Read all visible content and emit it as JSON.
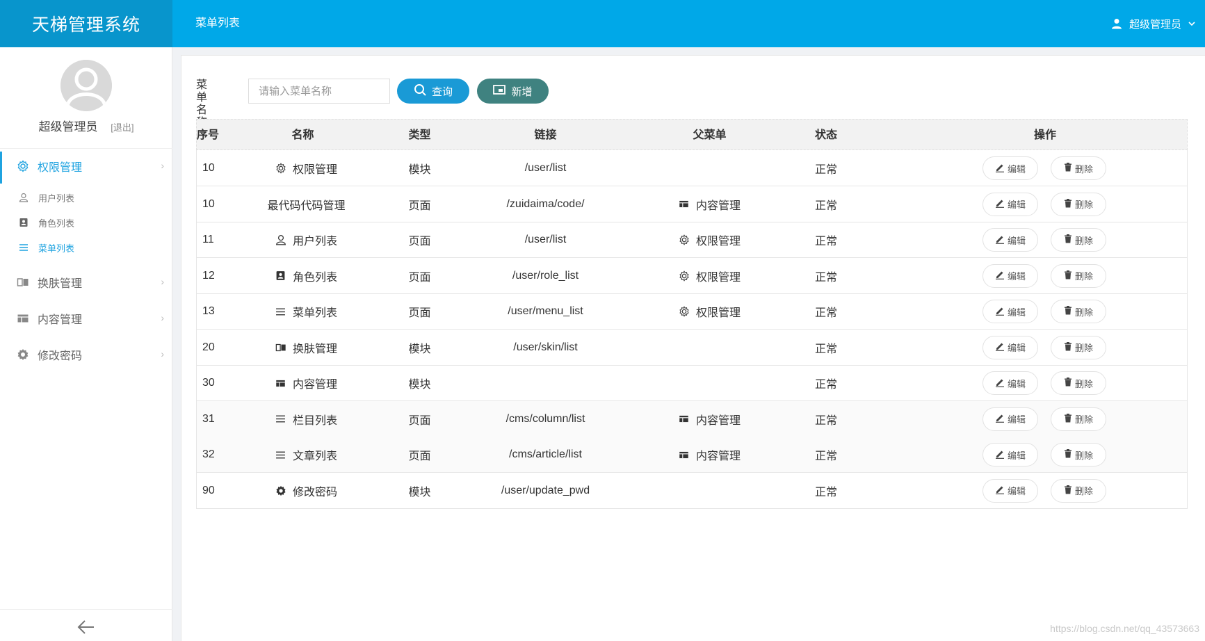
{
  "app": {
    "title": "天梯管理系统"
  },
  "header": {
    "breadcrumb": "菜单列表",
    "user_name": "超级管理员"
  },
  "sidebar": {
    "profile_name": "超级管理员",
    "logout": "[退出]",
    "items": [
      {
        "label": "权限管理",
        "icon": "gear-icon",
        "active": true
      },
      {
        "label": "换肤管理",
        "icon": "book-open-icon",
        "active": false
      },
      {
        "label": "内容管理",
        "icon": "table-icon",
        "active": false
      },
      {
        "label": "修改密码",
        "icon": "cog-icon",
        "active": false
      }
    ],
    "subitems": [
      {
        "label": "用户列表",
        "icon": "user-icon",
        "active": false
      },
      {
        "label": "角色列表",
        "icon": "id-card-icon",
        "active": false
      },
      {
        "label": "菜单列表",
        "icon": "list-icon",
        "active": true
      }
    ]
  },
  "search": {
    "label": "菜单名称",
    "placeholder": "请输入菜单名称",
    "query_button": "查询",
    "add_button": "新增"
  },
  "table": {
    "headers": [
      "序号",
      "名称",
      "类型",
      "链接",
      "父菜单",
      "状态",
      "操作"
    ],
    "edit_label": "编辑",
    "delete_label": "删除",
    "rows": [
      {
        "seq": "10",
        "name": "权限管理",
        "name_icon": "gear-icon",
        "type": "模块",
        "link": "/user/list",
        "parent": "",
        "parent_icon": "",
        "status": "正常"
      },
      {
        "seq": "10",
        "name": "最代码代码管理",
        "name_icon": "",
        "type": "页面",
        "link": "/zuidaima/code/",
        "parent": "内容管理",
        "parent_icon": "table-icon",
        "status": "正常"
      },
      {
        "seq": "11",
        "name": "用户列表",
        "name_icon": "user-icon",
        "type": "页面",
        "link": "/user/list",
        "parent": "权限管理",
        "parent_icon": "gear-icon",
        "status": "正常"
      },
      {
        "seq": "12",
        "name": "角色列表",
        "name_icon": "id-card-icon",
        "type": "页面",
        "link": "/user/role_list",
        "parent": "权限管理",
        "parent_icon": "gear-icon",
        "status": "正常"
      },
      {
        "seq": "13",
        "name": "菜单列表",
        "name_icon": "list-icon",
        "type": "页面",
        "link": "/user/menu_list",
        "parent": "权限管理",
        "parent_icon": "gear-icon",
        "status": "正常"
      },
      {
        "seq": "20",
        "name": "换肤管理",
        "name_icon": "book-open-icon",
        "type": "模块",
        "link": "/user/skin/list",
        "parent": "",
        "parent_icon": "",
        "status": "正常"
      },
      {
        "seq": "30",
        "name": "内容管理",
        "name_icon": "table-icon",
        "type": "模块",
        "link": "",
        "parent": "",
        "parent_icon": "",
        "status": "正常"
      },
      {
        "seq": "31",
        "name": "栏目列表",
        "name_icon": "list-icon",
        "type": "页面",
        "link": "/cms/column/list",
        "parent": "内容管理",
        "parent_icon": "table-icon",
        "status": "正常"
      },
      {
        "seq": "32",
        "name": "文章列表",
        "name_icon": "list-icon",
        "type": "页面",
        "link": "/cms/article/list",
        "parent": "内容管理",
        "parent_icon": "table-icon",
        "status": "正常"
      },
      {
        "seq": "90",
        "name": "修改密码",
        "name_icon": "cog-icon",
        "type": "模块",
        "link": "/user/update_pwd",
        "parent": "",
        "parent_icon": "",
        "status": "正常"
      }
    ]
  },
  "watermark": "https://blog.csdn.net/qq_43573663",
  "colors": {
    "header": "#00a8e8",
    "brand": "#0895cc",
    "accent": "#1fa3e0",
    "query_button": "#1a9ad6",
    "add_button": "#3f8280"
  }
}
